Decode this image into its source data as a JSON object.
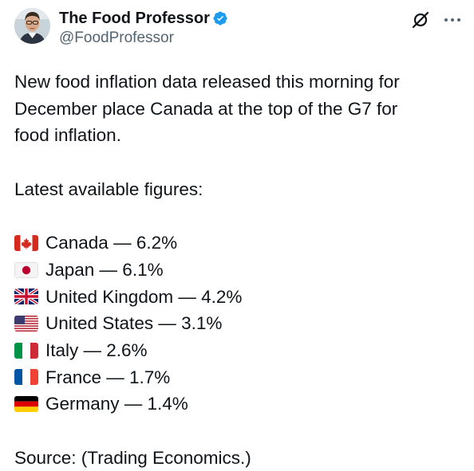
{
  "author": {
    "display_name": "The Food Professor",
    "handle": "@FoodProfessor",
    "verified": true,
    "verified_color": "#1d9bf0"
  },
  "actions": {
    "grok_icon": "grok-icon",
    "more_icon": "more-icon"
  },
  "tweet": {
    "intro_lines": [
      "New food inflation data released this morning for",
      "December place Canada at the top of the G7 for",
      "food inflation."
    ],
    "subheading": "Latest available figures:",
    "countries": [
      {
        "flag": "canada-flag-icon",
        "text": "Canada — 6.2%"
      },
      {
        "flag": "japan-flag-icon",
        "text": "Japan — 6.1%"
      },
      {
        "flag": "uk-flag-icon",
        "text": "United Kingdom — 4.2%"
      },
      {
        "flag": "us-flag-icon",
        "text": "United States — 3.1%"
      },
      {
        "flag": "italy-flag-icon",
        "text": "Italy — 2.6%"
      },
      {
        "flag": "france-flag-icon",
        "text": "France — 1.7%"
      },
      {
        "flag": "germany-flag-icon",
        "text": "Germany — 1.4%"
      }
    ],
    "source": "Source: (Trading Economics.)"
  }
}
